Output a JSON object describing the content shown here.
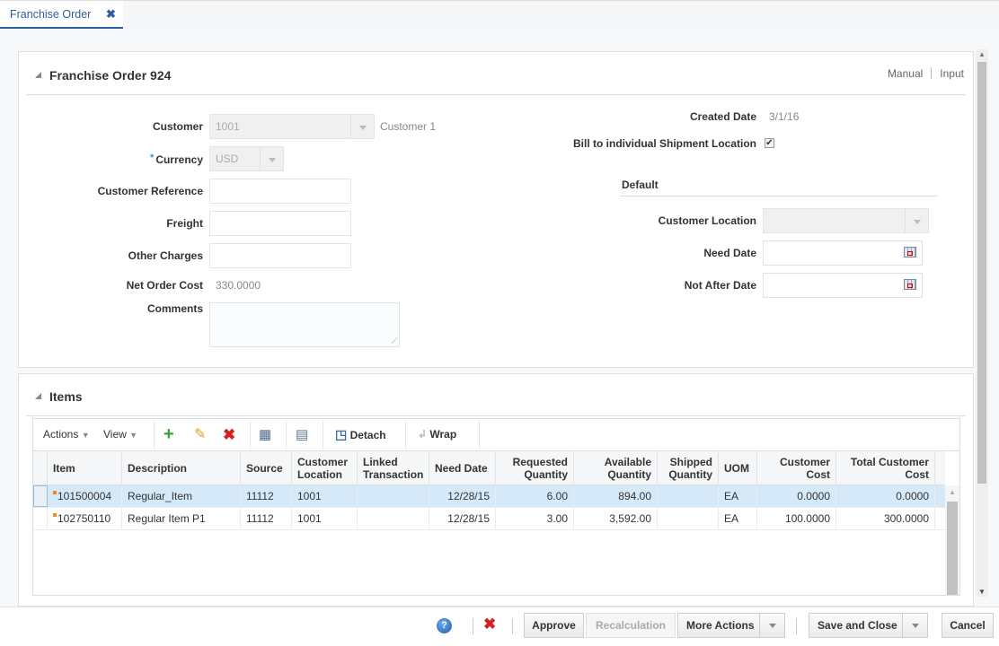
{
  "tabs": [
    {
      "label": "Franchise Order",
      "close": "✖"
    }
  ],
  "order": {
    "title": "Franchise Order 924",
    "links": [
      "Manual",
      "Input"
    ],
    "fields": {
      "customer": {
        "label": "Customer",
        "value": "1001",
        "description": "Customer 1"
      },
      "currency": {
        "label": "Currency",
        "required": "*",
        "value": "USD"
      },
      "customer_reference": {
        "label": "Customer Reference",
        "value": ""
      },
      "freight": {
        "label": "Freight",
        "value": ""
      },
      "other_charges": {
        "label": "Other Charges",
        "value": ""
      },
      "net_order_cost": {
        "label": "Net Order Cost",
        "value": "330.0000"
      },
      "comments": {
        "label": "Comments",
        "value": ""
      },
      "created_date": {
        "label": "Created Date",
        "value": "3/1/16"
      },
      "bill_to_individual": {
        "label": "Bill to individual Shipment Location",
        "checked": true,
        "glyph": "✔"
      }
    },
    "default": {
      "title": "Default",
      "customer_location": {
        "label": "Customer Location",
        "value": ""
      },
      "need_date": {
        "label": "Need Date",
        "value": ""
      },
      "not_after_date": {
        "label": "Not After Date",
        "value": ""
      }
    }
  },
  "items": {
    "title": "Items",
    "toolbar": {
      "actions": "Actions",
      "view": "View",
      "detach": "Detach",
      "wrap": "Wrap"
    },
    "columns": [
      "Item",
      "Description",
      "Source",
      "Customer Location",
      "Linked Transaction",
      "Need Date",
      "Requested Quantity",
      "Available Quantity",
      "Shipped Quantity",
      "UOM",
      "Customer Cost",
      "Total Customer Cost"
    ],
    "rows": [
      {
        "item": "101500004",
        "description": "Regular_Item",
        "source": "11112",
        "customer_location": "1001",
        "linked_transaction": "",
        "need_date": "12/28/15",
        "requested_qty": "6.00",
        "available_qty": "894.00",
        "shipped_qty": "",
        "uom": "EA",
        "customer_cost": "0.0000",
        "total_customer_cost": "0.0000",
        "selected": true
      },
      {
        "item": "102750110",
        "description": "Regular Item P1",
        "source": "11112",
        "customer_location": "1001",
        "linked_transaction": "",
        "need_date": "12/28/15",
        "requested_qty": "3.00",
        "available_qty": "3,592.00",
        "shipped_qty": "",
        "uom": "EA",
        "customer_cost": "100.0000",
        "total_customer_cost": "300.0000",
        "selected": false
      }
    ]
  },
  "footer": {
    "help": "?",
    "approve": "Approve",
    "recalculation": "Recalculation",
    "more_actions": "More Actions",
    "save_and_close": "Save and Close",
    "cancel": "Cancel"
  },
  "colors": {
    "accent": "#2d5f9e",
    "selected_row": "#d6e9f8",
    "item_marker": "#f08a1c"
  }
}
